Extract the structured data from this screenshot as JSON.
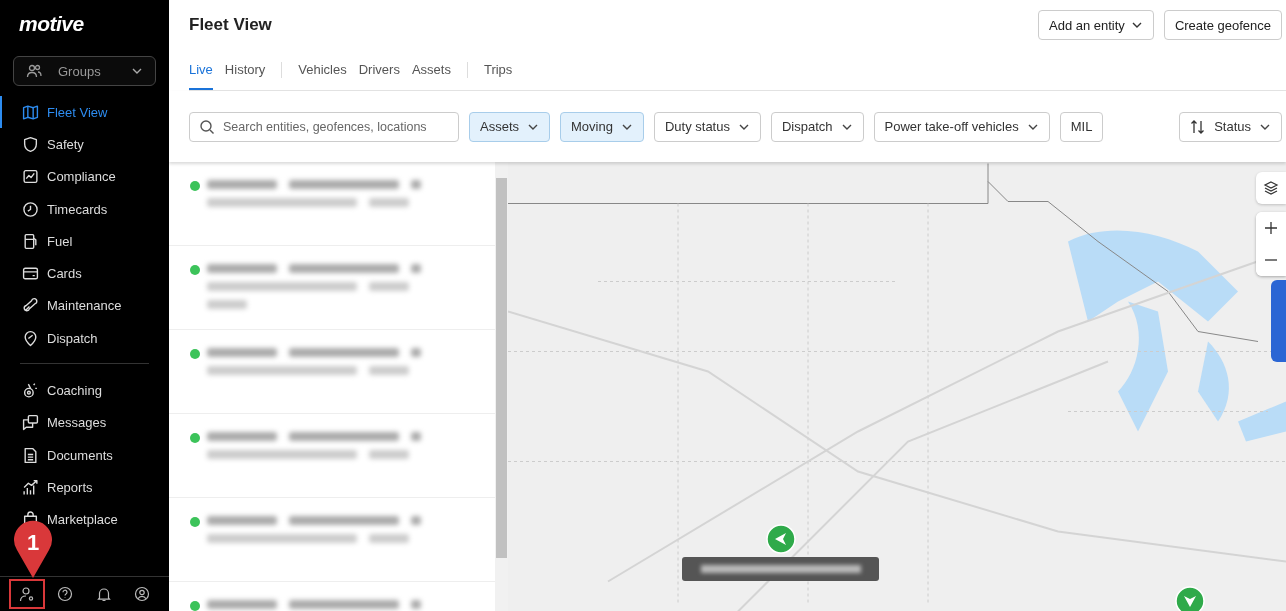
{
  "sidebar": {
    "logo": "motive",
    "groups": {
      "label": "Groups"
    },
    "nav_sections": [
      [
        {
          "label": "Fleet View",
          "selected": true
        },
        {
          "label": "Safety",
          "selected": false
        },
        {
          "label": "Compliance",
          "selected": false
        },
        {
          "label": "Timecards",
          "selected": false
        },
        {
          "label": "Fuel",
          "selected": false
        },
        {
          "label": "Cards",
          "selected": false
        },
        {
          "label": "Maintenance",
          "selected": false
        },
        {
          "label": "Dispatch",
          "selected": false
        }
      ],
      [
        {
          "label": "Coaching",
          "selected": false
        },
        {
          "label": "Messages",
          "selected": false
        },
        {
          "label": "Documents",
          "selected": false
        },
        {
          "label": "Reports",
          "selected": false
        },
        {
          "label": "Marketplace",
          "selected": false
        }
      ]
    ],
    "footer": [
      {
        "highlighted": true
      },
      {
        "highlighted": false
      },
      {
        "highlighted": false
      },
      {
        "highlighted": false
      }
    ],
    "callout": {
      "label": "1"
    }
  },
  "header": {
    "title": "Fleet View",
    "buttons": [
      {
        "label": "Add an entity",
        "kind": "dropdown"
      },
      {
        "label": "Create geofence",
        "kind": "plain"
      }
    ]
  },
  "tab_groups": [
    [
      {
        "label": "Live",
        "selected": true
      },
      {
        "label": "History",
        "selected": false
      }
    ],
    [
      {
        "label": "Vehicles",
        "selected": false
      },
      {
        "label": "Drivers",
        "selected": false
      },
      {
        "label": "Assets",
        "selected": false
      }
    ],
    [
      {
        "label": "Trips",
        "selected": false
      }
    ]
  ],
  "filters": {
    "search": {
      "placeholder": "Search entities, geofences, locations"
    },
    "chips": [
      {
        "label": "Assets",
        "kind": "dropdown",
        "active": true
      },
      {
        "label": "Moving",
        "kind": "dropdown",
        "active": true
      },
      {
        "label": "Duty status",
        "kind": "dropdown",
        "active": false
      },
      {
        "label": "Dispatch",
        "kind": "dropdown",
        "active": false
      },
      {
        "label": "Power take-off vehicles",
        "kind": "dropdown",
        "active": false
      },
      {
        "label": "MIL",
        "kind": "toggle",
        "active": false
      }
    ],
    "sort": {
      "label": "Status"
    }
  },
  "entity_list": {
    "rows": [
      {
        "color": "#3cc35a",
        "kind": "short"
      },
      {
        "color": "#3cc35a",
        "kind": "wrapped"
      },
      {
        "color": "#3cc35a",
        "kind": "short"
      },
      {
        "color": "#3cc35a",
        "kind": "short"
      },
      {
        "color": "#3cc35a",
        "kind": "short"
      },
      {
        "color": "#3cc35a",
        "kind": "short"
      }
    ]
  }
}
